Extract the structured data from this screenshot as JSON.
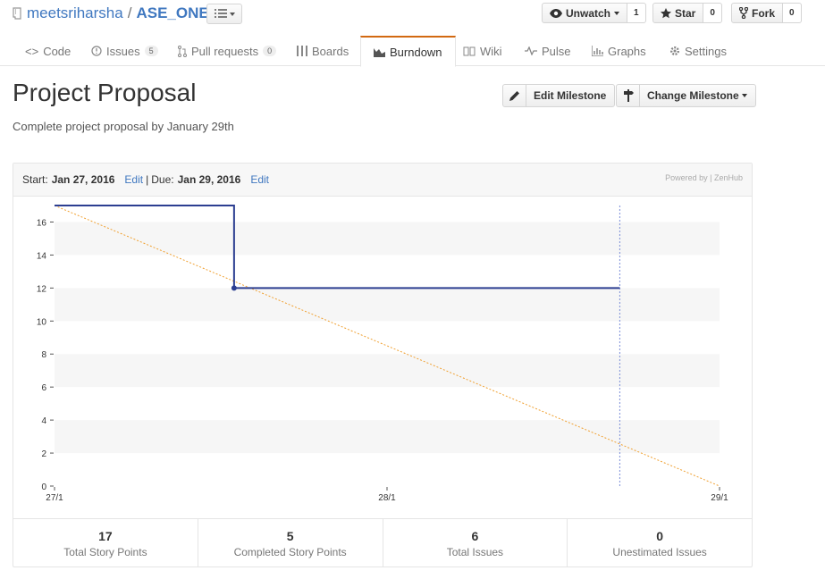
{
  "repo": {
    "owner": "meetsriharsha",
    "separator": "/",
    "name": "ASE_ONE"
  },
  "social": {
    "watch": {
      "label": "Unwatch",
      "count": "1"
    },
    "star": {
      "label": "Star",
      "count": "0"
    },
    "fork": {
      "label": "Fork",
      "count": "0"
    }
  },
  "tabs": [
    {
      "label": "Code",
      "icon": "code-icon"
    },
    {
      "label": "Issues",
      "count": "5",
      "icon": "issue-icon"
    },
    {
      "label": "Pull requests",
      "count": "0",
      "icon": "pull-request-icon"
    },
    {
      "label": "Boards",
      "icon": "boards-icon"
    },
    {
      "label": "Burndown",
      "icon": "burndown-icon",
      "selected": true
    },
    {
      "label": "Wiki",
      "icon": "wiki-icon"
    },
    {
      "label": "Pulse",
      "icon": "pulse-icon"
    },
    {
      "label": "Graphs",
      "icon": "graph-icon"
    },
    {
      "label": "Settings",
      "icon": "gear-icon"
    }
  ],
  "milestone": {
    "title": "Project Proposal",
    "description": "Complete project proposal by January 29th",
    "edit_label": "Edit Milestone",
    "change_label": "Change Milestone"
  },
  "panel": {
    "start_label": "Start:",
    "start_date": "Jan 27, 2016",
    "edit1": "Edit",
    "sep": "|",
    "due_label": "Due:",
    "due_date": "Jan 29, 2016",
    "edit2": "Edit",
    "powered": "Powered by | ZenHub"
  },
  "chart_data": {
    "type": "line",
    "x_ticks": [
      "27/1",
      "28/1",
      "29/1"
    ],
    "y_ticks": [
      0,
      2,
      4,
      6,
      8,
      10,
      12,
      14,
      16
    ],
    "ylim": [
      0,
      17
    ],
    "xlim": [
      0,
      2
    ],
    "series": [
      {
        "points": [
          [
            0,
            17
          ],
          [
            0.54,
            17
          ],
          [
            0.54,
            12
          ],
          [
            1.7,
            12
          ]
        ],
        "color": "#2c3e91",
        "style": "step"
      },
      {
        "points": [
          [
            0,
            17
          ],
          [
            2,
            0
          ]
        ],
        "color": "#f0a030",
        "style": "dotted"
      }
    ],
    "today_x": 1.7,
    "today_color": "#7b8ed8",
    "grid": true
  },
  "stats": [
    {
      "value": "17",
      "label": "Total Story Points"
    },
    {
      "value": "5",
      "label": "Completed Story Points"
    },
    {
      "value": "6",
      "label": "Total Issues"
    },
    {
      "value": "0",
      "label": "Unestimated Issues"
    }
  ]
}
